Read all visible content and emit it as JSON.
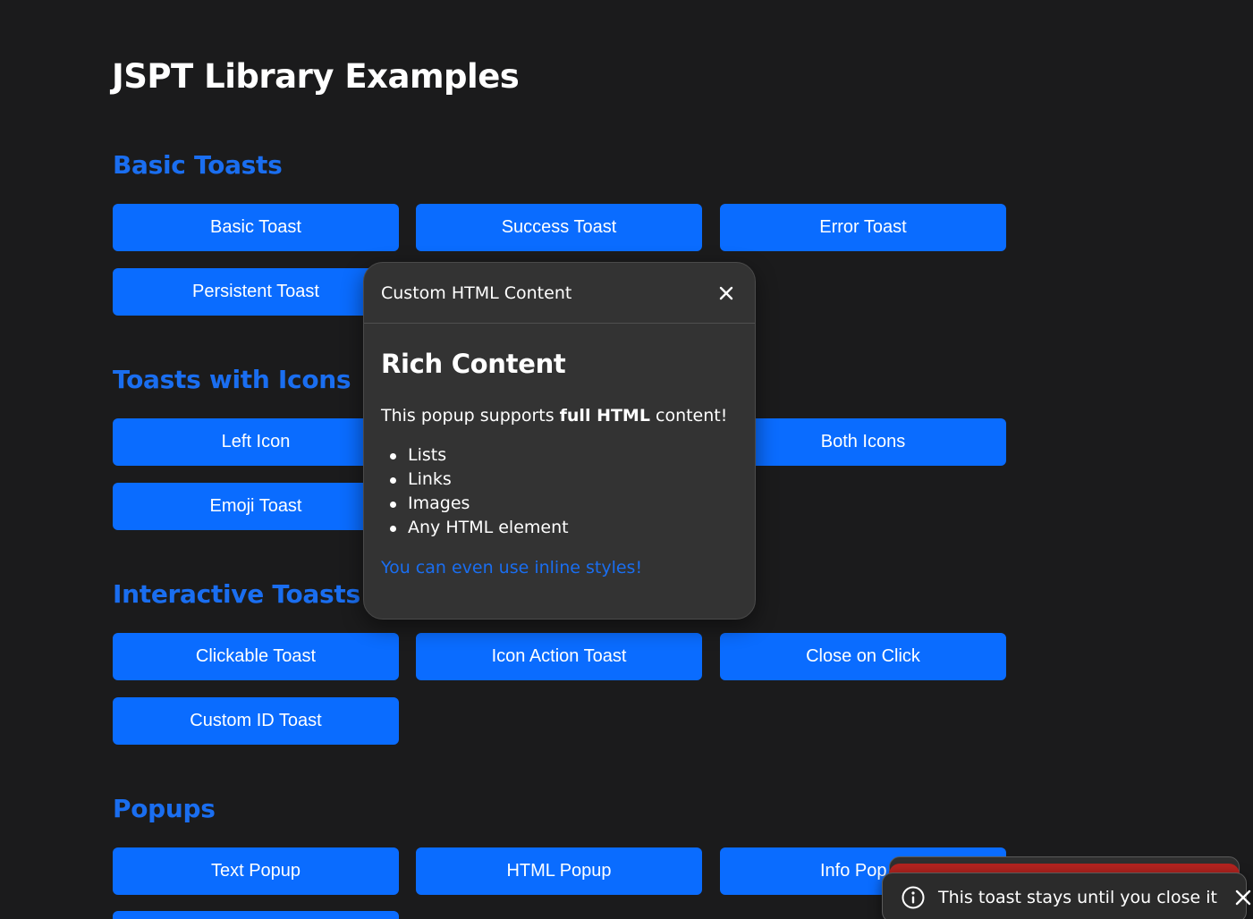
{
  "page": {
    "title": "JSPT Library Examples"
  },
  "sections": {
    "basic": {
      "title": "Basic Toasts",
      "buttons": [
        "Basic Toast",
        "Success Toast",
        "Error Toast",
        "Persistent Toast"
      ]
    },
    "icons": {
      "title": "Toasts with Icons",
      "buttons": [
        "Left Icon",
        "Both Icons",
        "Emoji Toast"
      ]
    },
    "interactive": {
      "title": "Interactive Toasts",
      "buttons": [
        "Clickable Toast",
        "Icon Action Toast",
        "Close on Click",
        "Custom ID Toast"
      ]
    },
    "popups": {
      "title": "Popups",
      "buttons": [
        "Text Popup",
        "HTML Popup",
        "Info Pop"
      ]
    }
  },
  "popup": {
    "title": "Custom HTML Content",
    "heading": "Rich Content",
    "text_before": "This popup supports ",
    "text_bold": "full HTML",
    "text_after": " content!",
    "list": [
      "Lists",
      "Links",
      "Images",
      "Any HTML element"
    ],
    "styled_text": "You can even use inline styles!",
    "close_icon": "close-icon"
  },
  "toast": {
    "text": "This toast stays until you close it",
    "icon": "info-icon",
    "close_icon": "close-icon",
    "stack_color": "#b3231f"
  },
  "colors": {
    "background": "#1b1b1c",
    "accent": "#0a6cff",
    "section_title": "#1a6ef0",
    "popup_bg": "#333333"
  }
}
